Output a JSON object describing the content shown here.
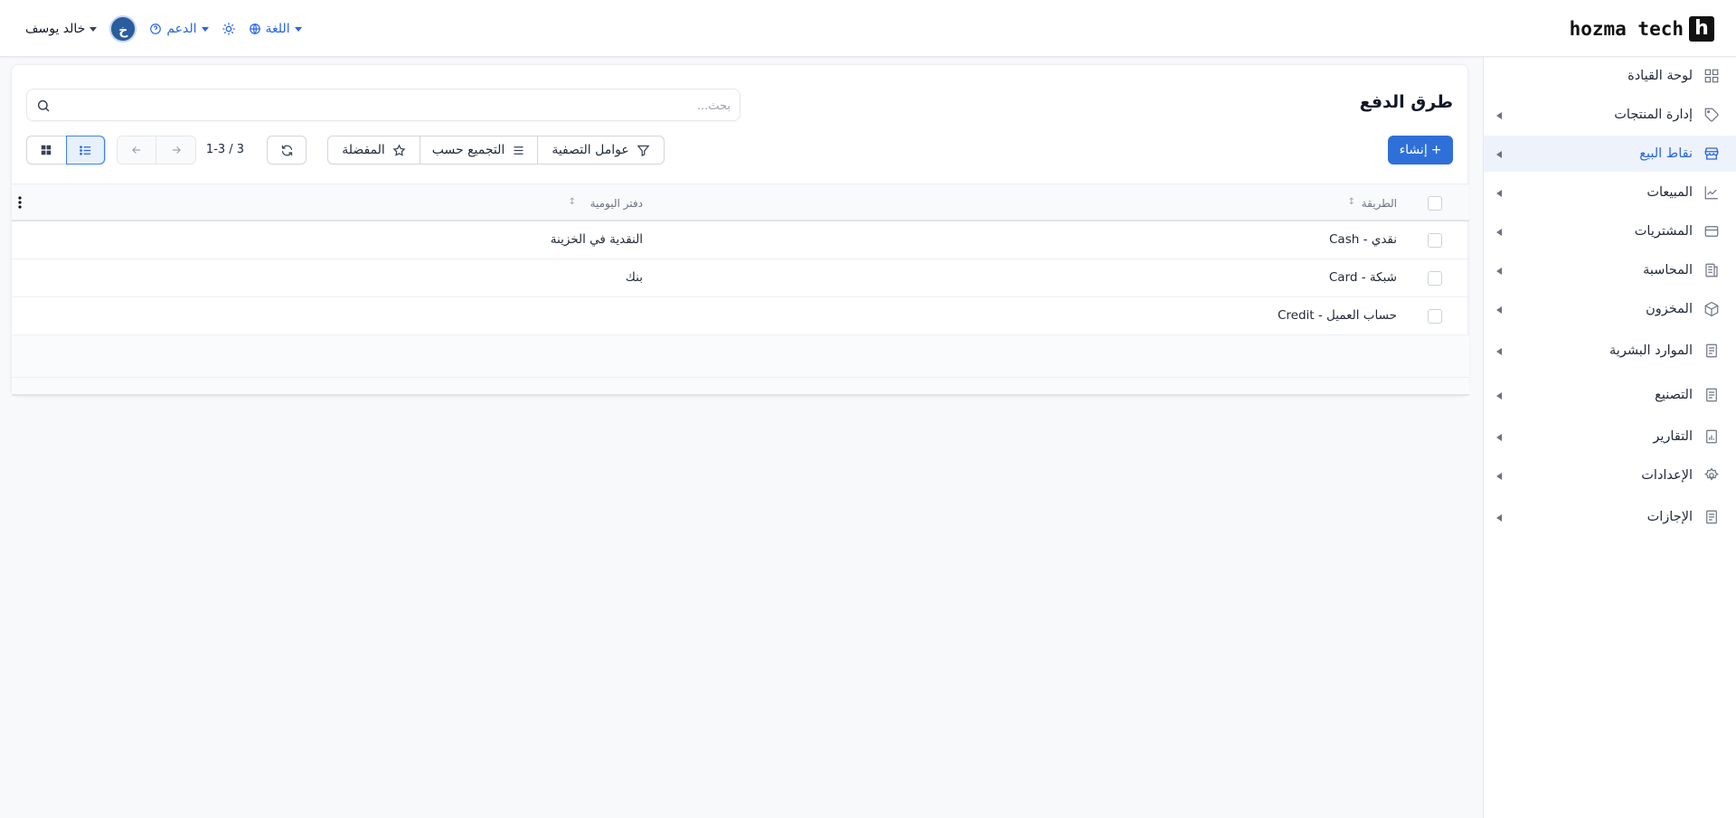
{
  "header": {
    "brand": "hozma tech",
    "brand_mark": "h",
    "language_label": "اللغة",
    "support_label": "الدعم",
    "user_initial": "خ",
    "user_name": "خالد يوسف"
  },
  "sidebar": {
    "items": [
      {
        "label": "لوحة القيادة",
        "icon": "dashboard-icon",
        "has_children": false,
        "active": false
      },
      {
        "label": "إدارة المنتجات",
        "icon": "tag-icon",
        "has_children": true,
        "active": false
      },
      {
        "label": "نقاط البيع",
        "icon": "store-icon",
        "has_children": true,
        "active": true
      },
      {
        "label": "المبيعات",
        "icon": "chart-line-icon",
        "has_children": true,
        "active": false
      },
      {
        "label": "المشتريات",
        "icon": "wallet-icon",
        "has_children": true,
        "active": false
      },
      {
        "label": "المحاسبة",
        "icon": "ledger-icon",
        "has_children": true,
        "active": false
      },
      {
        "label": "المخزون",
        "icon": "box-icon",
        "has_children": true,
        "active": false
      },
      {
        "label": "الموارد البشرية",
        "icon": "document-icon",
        "has_children": true,
        "active": false
      },
      {
        "label": "التصنيع",
        "icon": "document-icon",
        "has_children": true,
        "active": false
      },
      {
        "label": "التقارير",
        "icon": "report-icon",
        "has_children": true,
        "active": false
      },
      {
        "label": "الإعدادات",
        "icon": "gear-icon",
        "has_children": true,
        "active": false
      },
      {
        "label": "الإجازات",
        "icon": "document-icon",
        "has_children": true,
        "active": false
      }
    ]
  },
  "main": {
    "title": "طرق الدفع",
    "search_placeholder": "بحث...",
    "search_value": "",
    "create_label": "إنشاء",
    "filters_label": "عوامل التصفية",
    "group_by_label": "التجميع حسب",
    "favorites_label": "المفضلة",
    "pager_text": "1-3 / 3",
    "view_mode": "list"
  },
  "table": {
    "columns": [
      "الطريقة",
      "دفتر اليومية"
    ],
    "rows": [
      [
        "نقدي - Cash",
        "النقدية في الخزينة"
      ],
      [
        "شبكة - Card",
        "بنك"
      ],
      [
        "حساب العميل - Credit",
        ""
      ]
    ]
  },
  "colors": {
    "primary": "#2f6fd8",
    "accent_text": "#2563eb",
    "active_nav_bg": "#eef3fb",
    "avatar": "#2b5c9e"
  }
}
